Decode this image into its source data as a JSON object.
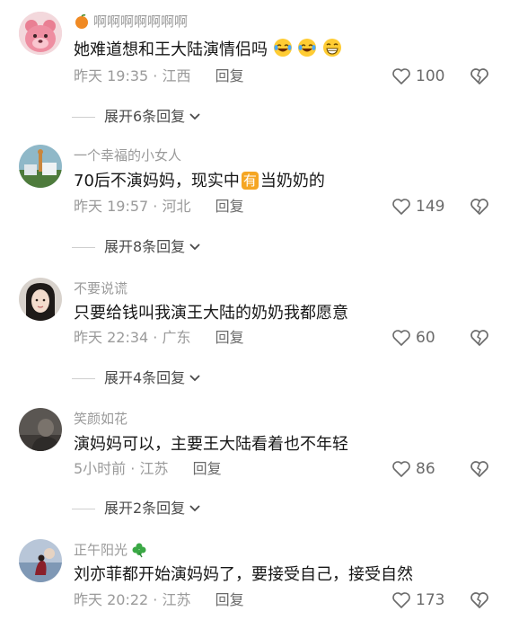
{
  "comments": [
    {
      "username": "啊啊啊啊啊啊啊",
      "text": "她难道想和王大陆演情侣吗",
      "emojis": [
        "crying-laughing",
        "crying-laughing",
        "grin"
      ],
      "time": "昨天 19:35",
      "location": "江西",
      "reply_label": "回复",
      "likes": "100",
      "expand_label": "展开6条回复"
    },
    {
      "username": "一个幸福的小女人",
      "text_before": "70后不演妈妈，现实中",
      "text_badge": "有",
      "text_after": "当奶奶的",
      "time": "昨天 19:57",
      "location": "河北",
      "reply_label": "回复",
      "likes": "149",
      "expand_label": "展开8条回复"
    },
    {
      "username": "不要说谎",
      "text": "只要给钱叫我演王大陆的奶奶我都愿意",
      "time": "昨天 22:34",
      "location": "广东",
      "reply_label": "回复",
      "likes": "60",
      "expand_label": "展开4条回复"
    },
    {
      "username": "笑颜如花",
      "text": "演妈妈可以，主要王大陆看着也不年轻",
      "time": "5小时前",
      "location": "江苏",
      "reply_label": "回复",
      "likes": "86",
      "expand_label": "展开2条回复"
    },
    {
      "username": "正午阳光",
      "text": "刘亦菲都开始演妈妈了，要接受自己，接受自然",
      "time": "昨天 20:22",
      "location": "江苏",
      "reply_label": "回复",
      "likes": "173"
    }
  ],
  "separator": " · ",
  "colors": {
    "text": "#161616",
    "meta": "#9a9a9a",
    "badge": "#f5a623",
    "clover": "#3aa845"
  }
}
